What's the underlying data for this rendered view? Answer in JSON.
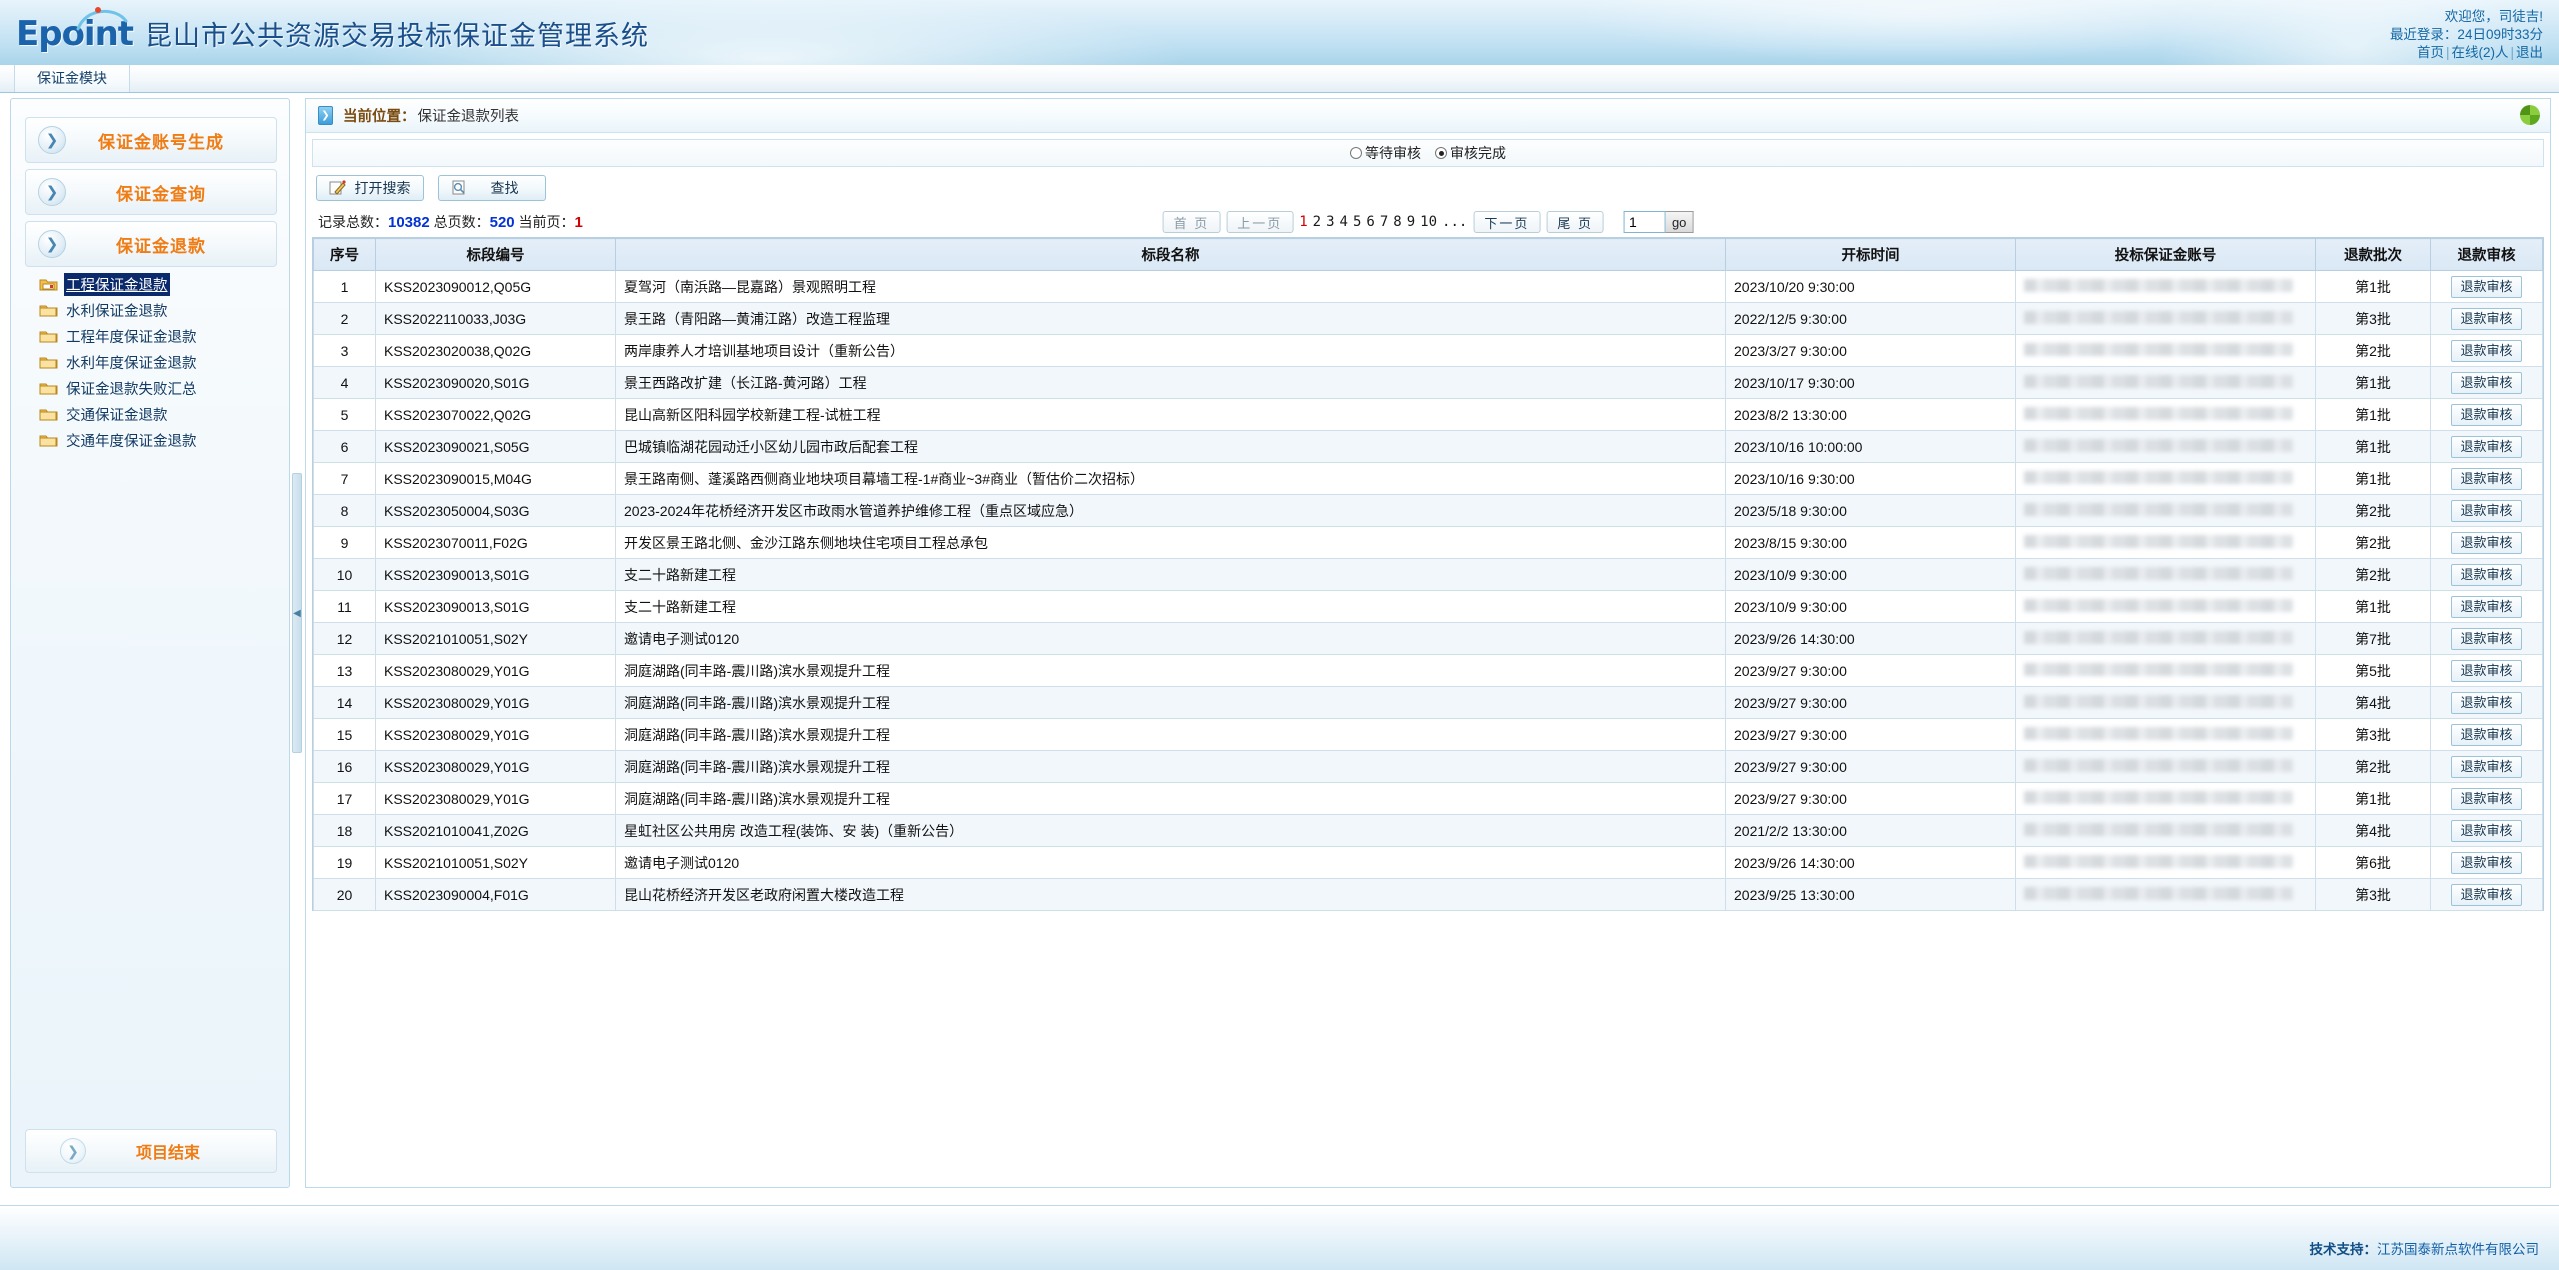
{
  "header": {
    "logo_text": "Epoint",
    "system_title": "昆山市公共资源交易投标保证金管理系统",
    "welcome": "欢迎您，司徒吉!",
    "last_login": "最近登录：24日09时33分",
    "link_home": "首页",
    "link_online": "在线(2)人",
    "link_logout": "退出",
    "sep": "|"
  },
  "tabbar": {
    "module_tab": "保证金模块"
  },
  "sidebar": {
    "menus": [
      {
        "label": "保证金账号生成"
      },
      {
        "label": "保证金查询"
      },
      {
        "label": "保证金退款"
      }
    ],
    "tree": [
      {
        "label": "工程保证金退款",
        "selected": true
      },
      {
        "label": "水利保证金退款",
        "selected": false
      },
      {
        "label": "工程年度保证金退款",
        "selected": false
      },
      {
        "label": "水利年度保证金退款",
        "selected": false
      },
      {
        "label": "保证金退款失败汇总",
        "selected": false
      },
      {
        "label": "交通保证金退款",
        "selected": false
      },
      {
        "label": "交通年度保证金退款",
        "selected": false
      }
    ],
    "bottom_menu": "项目结束"
  },
  "content": {
    "breadcrumb_label": "当前位置：",
    "breadcrumb_value": "保证金退款列表",
    "radios": [
      {
        "label": "等待审核",
        "checked": false
      },
      {
        "label": "审核完成",
        "checked": true
      }
    ],
    "buttons": [
      {
        "label": "打开搜索",
        "icon": "pencil-icon"
      },
      {
        "label": "查找",
        "icon": "search-icon"
      }
    ],
    "pager": {
      "total_records_label": "记录总数：",
      "total_records": "10382",
      "total_pages_label": "总页数：",
      "total_pages": "520",
      "current_page_label": "当前页：",
      "current_page": "1",
      "first": "首 页",
      "prev": "上一页",
      "next": "下一页",
      "last": "尾 页",
      "numbers": [
        "1",
        "2",
        "3",
        "4",
        "5",
        "6",
        "7",
        "8",
        "9",
        "10",
        "..."
      ],
      "current_number": "1",
      "goto_value": "1",
      "go_label": "go"
    },
    "table": {
      "columns": [
        "序号",
        "标段编号",
        "标段名称",
        "开标时间",
        "投标保证金账号",
        "退款批次",
        "退款审核"
      ],
      "audit_button_label": "退款审核",
      "rows": [
        {
          "idx": "1",
          "num": "KSS2023090012,Q05G",
          "name": "夏驾河（南浜路—昆嘉路）景观照明工程",
          "time": "2023/10/20 9:30:00",
          "batch": "第1批"
        },
        {
          "idx": "2",
          "num": "KSS2022110033,J03G",
          "name": "景王路（青阳路—黄浦江路）改造工程监理",
          "time": "2022/12/5 9:30:00",
          "batch": "第3批"
        },
        {
          "idx": "3",
          "num": "KSS2023020038,Q02G",
          "name": "两岸康养人才培训基地项目设计（重新公告）",
          "time": "2023/3/27 9:30:00",
          "batch": "第2批"
        },
        {
          "idx": "4",
          "num": "KSS2023090020,S01G",
          "name": "景王西路改扩建（长江路-黄河路）工程",
          "time": "2023/10/17 9:30:00",
          "batch": "第1批"
        },
        {
          "idx": "5",
          "num": "KSS2023070022,Q02G",
          "name": "昆山高新区阳科园学校新建工程-试桩工程",
          "time": "2023/8/2 13:30:00",
          "batch": "第1批"
        },
        {
          "idx": "6",
          "num": "KSS2023090021,S05G",
          "name": "巴城镇临湖花园动迁小区幼儿园市政后配套工程",
          "time": "2023/10/16 10:00:00",
          "batch": "第1批"
        },
        {
          "idx": "7",
          "num": "KSS2023090015,M04G",
          "name": "景王路南侧、蓬溪路西侧商业地块项目幕墙工程-1#商业~3#商业（暂估价二次招标）",
          "time": "2023/10/16 9:30:00",
          "batch": "第1批"
        },
        {
          "idx": "8",
          "num": "KSS2023050004,S03G",
          "name": "2023-2024年花桥经济开发区市政雨水管道养护维修工程（重点区域应急）",
          "time": "2023/5/18 9:30:00",
          "batch": "第2批"
        },
        {
          "idx": "9",
          "num": "KSS2023070011,F02G",
          "name": "开发区景王路北侧、金沙江路东侧地块住宅项目工程总承包",
          "time": "2023/8/15 9:30:00",
          "batch": "第2批"
        },
        {
          "idx": "10",
          "num": "KSS2023090013,S01G",
          "name": "支二十路新建工程",
          "time": "2023/10/9 9:30:00",
          "batch": "第2批"
        },
        {
          "idx": "11",
          "num": "KSS2023090013,S01G",
          "name": "支二十路新建工程",
          "time": "2023/10/9 9:30:00",
          "batch": "第1批"
        },
        {
          "idx": "12",
          "num": "KSS2021010051,S02Y",
          "name": "邀请电子测试0120",
          "time": "2023/9/26 14:30:00",
          "batch": "第7批"
        },
        {
          "idx": "13",
          "num": "KSS2023080029,Y01G",
          "name": "洞庭湖路(同丰路-震川路)滨水景观提升工程",
          "time": "2023/9/27 9:30:00",
          "batch": "第5批"
        },
        {
          "idx": "14",
          "num": "KSS2023080029,Y01G",
          "name": "洞庭湖路(同丰路-震川路)滨水景观提升工程",
          "time": "2023/9/27 9:30:00",
          "batch": "第4批"
        },
        {
          "idx": "15",
          "num": "KSS2023080029,Y01G",
          "name": "洞庭湖路(同丰路-震川路)滨水景观提升工程",
          "time": "2023/9/27 9:30:00",
          "batch": "第3批"
        },
        {
          "idx": "16",
          "num": "KSS2023080029,Y01G",
          "name": "洞庭湖路(同丰路-震川路)滨水景观提升工程",
          "time": "2023/9/27 9:30:00",
          "batch": "第2批"
        },
        {
          "idx": "17",
          "num": "KSS2023080029,Y01G",
          "name": "洞庭湖路(同丰路-震川路)滨水景观提升工程",
          "time": "2023/9/27 9:30:00",
          "batch": "第1批"
        },
        {
          "idx": "18",
          "num": "KSS2021010041,Z02G",
          "name": "星虹社区公共用房 改造工程(装饰、安 装)（重新公告）",
          "time": "2021/2/2 13:30:00",
          "batch": "第4批"
        },
        {
          "idx": "19",
          "num": "KSS2021010051,S02Y",
          "name": "邀请电子测试0120",
          "time": "2023/9/26 14:30:00",
          "batch": "第6批"
        },
        {
          "idx": "20",
          "num": "KSS2023090004,F01G",
          "name": "昆山花桥经济开发区老政府闲置大楼改造工程",
          "time": "2023/9/25 13:30:00",
          "batch": "第3批"
        }
      ]
    }
  },
  "footer": {
    "support_label": "技术支持：",
    "support_company": "江苏国泰新点软件有限公司"
  },
  "colors": {
    "accent_orange": "#f07c14",
    "link_blue": "#1468a5",
    "header_blue": "#1b4f8a",
    "selected_bg": "#0b2a6b",
    "stat_blue": "#0432d6",
    "stat_red": "#d40000"
  }
}
